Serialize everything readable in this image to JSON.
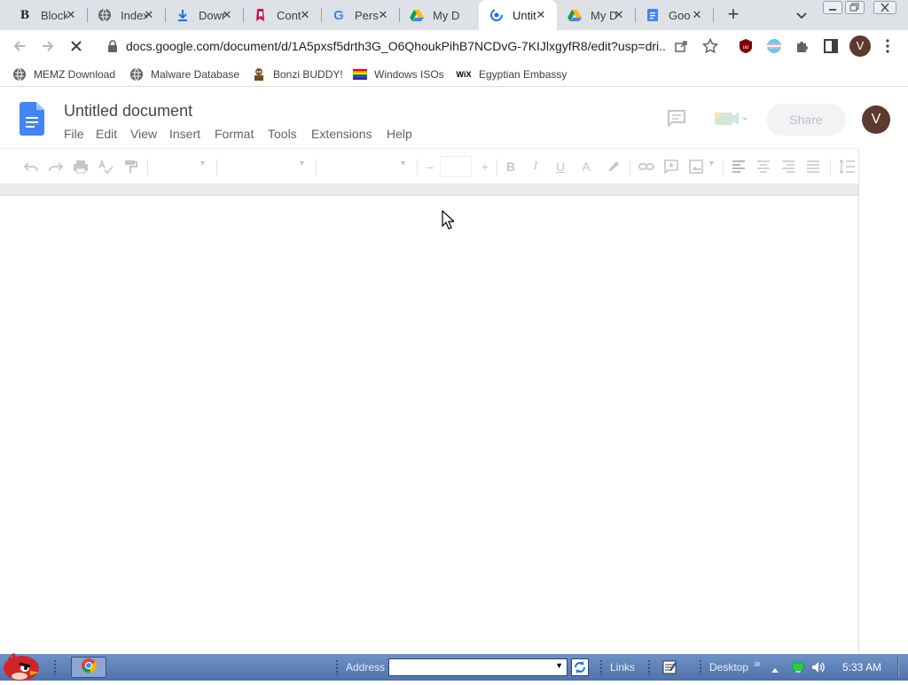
{
  "browser": {
    "tabs": [
      {
        "title": "Block",
        "icon": "bold-b-icon",
        "active": false
      },
      {
        "title": "Index",
        "icon": "globe-icon",
        "active": false
      },
      {
        "title": "Down",
        "icon": "download-icon",
        "active": false
      },
      {
        "title": "Cont",
        "icon": "bookmark-tag-icon",
        "active": false
      },
      {
        "title": "Pers",
        "icon": "google-g-icon",
        "active": false
      },
      {
        "title": "My D",
        "icon": "google-drive-icon",
        "active": false
      },
      {
        "title": "Untit",
        "icon": "loading-icon",
        "active": true
      },
      {
        "title": "My D",
        "icon": "google-drive-icon",
        "active": false
      },
      {
        "title": "Goo",
        "icon": "google-docs-icon",
        "active": false
      }
    ],
    "close_glyph": "✕",
    "new_tab_glyph": "+",
    "url": "docs.google.com/document/d/1A5pxsf5drth3G_O6QhoukPihB7NCDvG-7KIJlxgyfR8/edit?usp=dri...",
    "profile_initial": "V",
    "bookmarks": [
      {
        "label": "MEMZ Download",
        "icon": "globe-icon"
      },
      {
        "label": "Malware Database",
        "icon": "globe-icon"
      },
      {
        "label": "Bonzi BUDDY!",
        "icon": "bonzi-icon"
      },
      {
        "label": "Windows ISOs",
        "icon": "rainbow-flag-icon"
      },
      {
        "label": "Egyptian Embassy",
        "icon": "wix-icon"
      }
    ],
    "wix_text": "WiX"
  },
  "docs": {
    "title": "Untitled document",
    "menus": [
      "File",
      "Edit",
      "View",
      "Insert",
      "Format",
      "Tools",
      "Extensions",
      "Help"
    ],
    "share_label": "Share",
    "avatar_initial": "V",
    "font_size_minus": "–",
    "font_size_plus": "+",
    "bold": "B",
    "italic": "I",
    "underline": "U",
    "text_color": "A"
  },
  "taskbar": {
    "address_label": "Address",
    "links_label": "Links",
    "desktop_label": "Desktop",
    "chevron": "»",
    "clock": "5:33 AM"
  },
  "colors": {
    "tab_strip": "#dee1e6",
    "docs_blue": "#4285f4",
    "avatar": "#5d3a2e",
    "taskbar": "#5a7db5"
  }
}
